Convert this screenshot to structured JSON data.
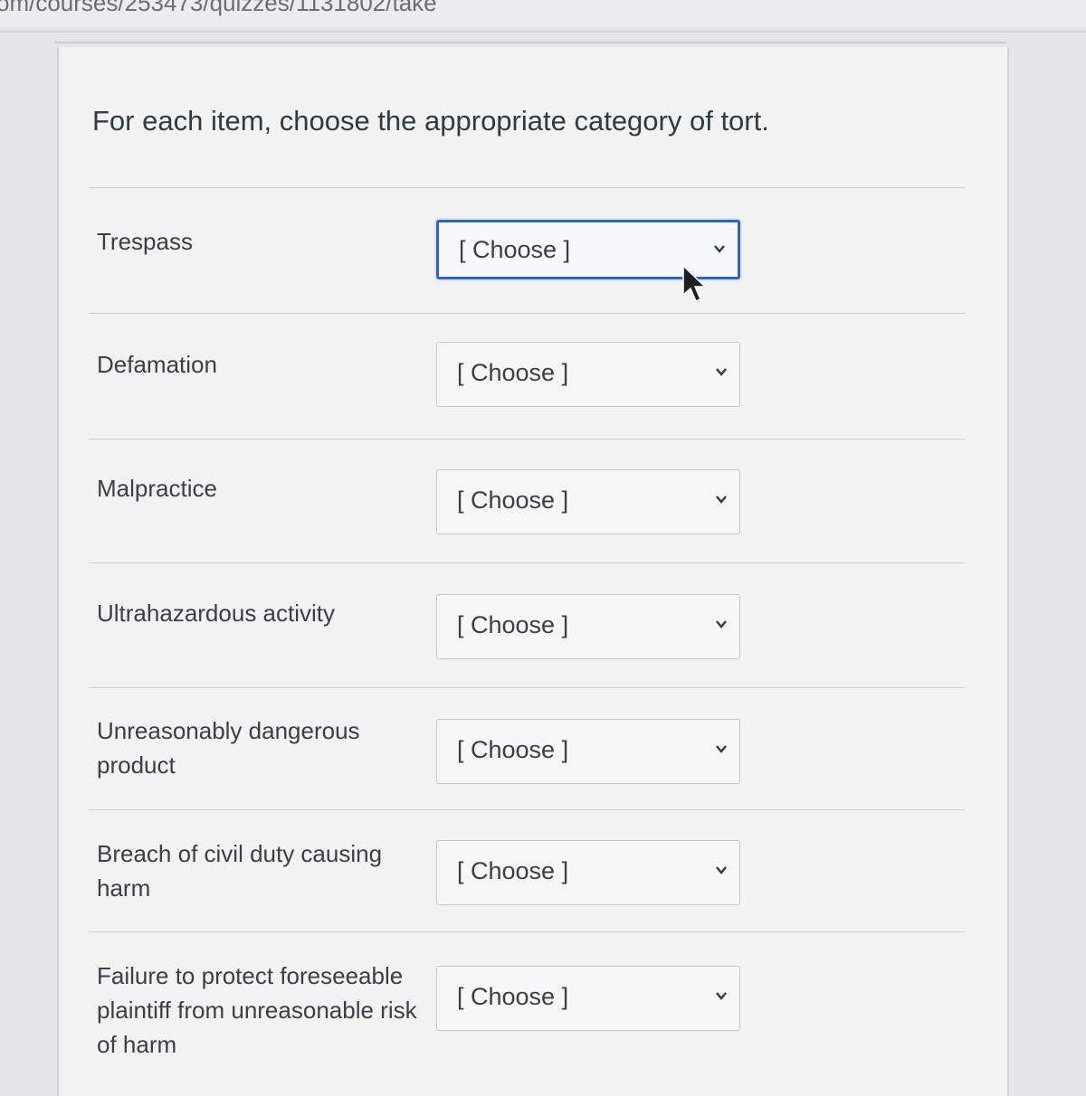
{
  "browser": {
    "url_fragment": "om/courses/253473/quizzes/1131802/take"
  },
  "question": {
    "prompt": "For each item, choose the appropriate category of tort."
  },
  "rows": [
    {
      "label": "Trespass",
      "select_value": "[ Choose ]"
    },
    {
      "label": "Defamation",
      "select_value": "[ Choose ]"
    },
    {
      "label": "Malpractice",
      "select_value": "[ Choose ]"
    },
    {
      "label": "Ultrahazardous activity",
      "select_value": "[ Choose ]"
    },
    {
      "label": "Unreasonably dangerous product",
      "select_value": "[ Choose ]"
    },
    {
      "label": "Breach of civil duty causing harm",
      "select_value": "[ Choose ]"
    },
    {
      "label": "Failure to protect foreseeable plaintiff from unreasonable risk of harm",
      "select_value": "[ Choose ]"
    }
  ],
  "colors": {
    "focus_border": "#2b64c6",
    "text": "#2d3b45",
    "panel_bg": "#f2f2f3"
  },
  "icons": {
    "select_indicator": "chevron-down-icon",
    "pointer": "mouse-cursor-icon"
  }
}
